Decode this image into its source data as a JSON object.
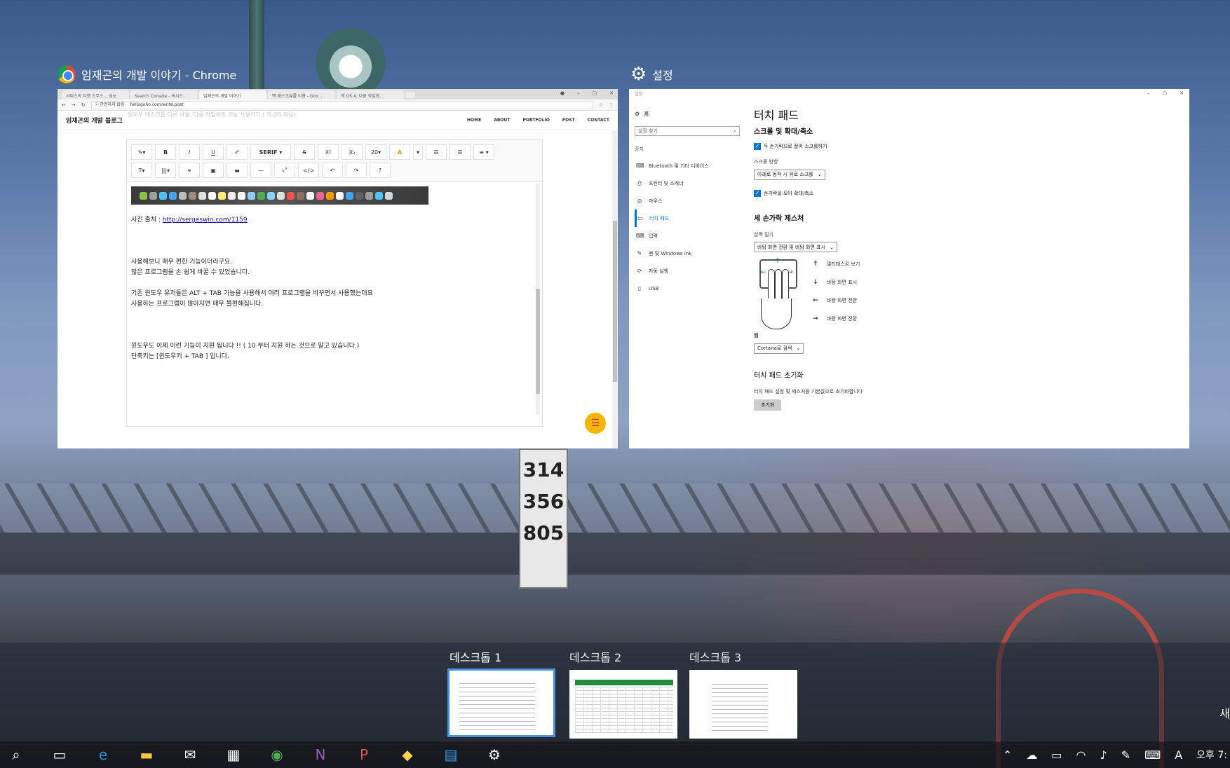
{
  "windows": {
    "chrome_title": "임재곤의 개발 이야기 - Chrome",
    "settings_title": "설정"
  },
  "chrome": {
    "tabs": [
      "사피스의 티켓 스무스... 성능",
      "Search Console - 속시스...",
      "임재곤의 개발 이야기",
      "맥 태스크뷰를 이용 - Goo...",
      "맥 OS X, 다중 작업화..."
    ],
    "address_prefix": "안전하지 않음",
    "address_url": "hellogoho.com/write.post",
    "blog_brand": "임재곤의 개발 블로그",
    "faded_heading": "윈도우 데스크톱 다른 사용, 다중 작업화면 기능 사용하기 ( 맥 OS 처럼)",
    "nav": [
      "HOME",
      "ABOUT",
      "PORTFOLIO",
      "POST",
      "CONTACT"
    ],
    "toolbar_row1": [
      "✎▾",
      "B",
      "I",
      "U",
      "✐",
      "SERIF ▾",
      "S",
      "X²",
      "X₂",
      "20▾",
      "A",
      "▾",
      "☰",
      "☰",
      "≡ ▾"
    ],
    "toolbar_row2": [
      "T▾",
      "|||▾",
      "⚭",
      "▣",
      "▬",
      "—",
      "⤢",
      "</>",
      "↶",
      "↷",
      "?"
    ],
    "body": {
      "source_label": "사진 출처 : ",
      "source_link": "http://sergeswin.com/1159",
      "p1_l1": "사용해보니 매우 편한 기능이더라구요.",
      "p1_l2": "많은 프로그램을 손 쉽게 바꿀 수 있었습니다.",
      "p2_l1": "기존 윈도우 유저들은 ALT + TAB 기능을 사용해서 여러 프로그램을 바꾸면서 사용했는데요",
      "p2_l2": "사용하는 프로그램이 많아지면 매우 불편해집니다.",
      "p3_l1": "윈도우도 이제 이런 기능이 지원 됩니다 !! ( 10 부터 지원 하는 것으로 알고 있습니다.)",
      "p3_l2": "단축키는 [윈도우키 + TAB ] 입니다."
    }
  },
  "settings": {
    "top_label": "설정",
    "home": "홈",
    "search_placeholder": "설정 찾기",
    "group": "장치",
    "side_items": [
      "Bluetooth 및 기타 디바이스",
      "프린터 및 스캐너",
      "마우스",
      "터치 패드",
      "입력",
      "펜 및 Windows Ink",
      "자동 실행",
      "USB"
    ],
    "side_icons": [
      "⌨",
      "⎙",
      "◎",
      "▭",
      "⌨",
      "✎",
      "⟳",
      "▯"
    ],
    "title": "터치 패드",
    "scroll_heading": "스크롤 및 확대/축소",
    "chk1": "두 손가락으로 끌어 스크롤하기",
    "scroll_dir_label": "스크롤 방향",
    "scroll_dir_value": "아래로 동작 시 위로 스크롤",
    "chk2": "손가락을 모아 확대/축소",
    "three_heading": "세 손가락 제스처",
    "swipe_label": "살짝 밀기",
    "swipe_value": "바탕 화면 전환 및 바탕 화면 표시",
    "gestures": [
      {
        "arrow": "↑",
        "label": "멀티태스킹 보기"
      },
      {
        "arrow": "↓",
        "label": "바탕 화면 표시"
      },
      {
        "arrow": "←",
        "label": "바탕 화면 전환"
      },
      {
        "arrow": "→",
        "label": "바탕 화면 전환"
      }
    ],
    "tap_label": "탭",
    "tap_value": "Cortana로 검색",
    "reset_heading": "터치 패드 초기화",
    "reset_desc": "터치 패드 설정 및 제스처를 기본값으로 초기화합니다",
    "reset_button": "초기화"
  },
  "desktops": [
    {
      "label": "데스크톱 1",
      "active": true
    },
    {
      "label": "데스크톱 2",
      "active": false
    },
    {
      "label": "데스크톱 3",
      "active": false
    }
  ],
  "new_desktop": "새",
  "taskbar": {
    "icons": [
      "search-icon",
      "task-view-icon",
      "edge-icon",
      "file-explorer-icon",
      "mail-icon",
      "store-icon",
      "chrome-icon",
      "onenote-icon",
      "powerpoint-icon",
      "kakaotalk-icon",
      "office-icon",
      "settings-icon"
    ],
    "clock": "오후 7:",
    "ime": "A"
  },
  "background_sign": [
    "314",
    "356",
    "805"
  ]
}
